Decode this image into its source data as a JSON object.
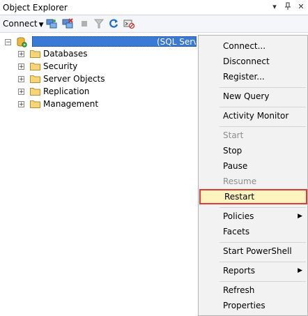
{
  "window": {
    "title": "Object Explorer",
    "pin_icon": "pin-icon",
    "dropdown_icon": "dropdown-icon",
    "close_icon": "close-icon"
  },
  "toolbar": {
    "connect_label": "Connect",
    "icons": [
      "connect-object-explorer-icon",
      "disconnect-icon",
      "stop-icon",
      "filter-icon",
      "refresh-icon",
      "start-powershell-icon"
    ]
  },
  "tree": {
    "server_label": "(SQL Server",
    "nodes": [
      {
        "label": "Databases"
      },
      {
        "label": "Security"
      },
      {
        "label": "Server Objects"
      },
      {
        "label": "Replication"
      },
      {
        "label": "Management"
      }
    ]
  },
  "context_menu": {
    "items": [
      {
        "label": "Connect...",
        "enabled": true
      },
      {
        "label": "Disconnect",
        "enabled": true
      },
      {
        "label": "Register...",
        "enabled": true
      },
      {
        "label": "New Query",
        "enabled": true
      },
      {
        "label": "Activity Monitor",
        "enabled": true
      },
      {
        "label": "Start",
        "enabled": false
      },
      {
        "label": "Stop",
        "enabled": true
      },
      {
        "label": "Pause",
        "enabled": true
      },
      {
        "label": "Resume",
        "enabled": false
      },
      {
        "label": "Restart",
        "enabled": true,
        "highlighted": true
      },
      {
        "label": "Policies",
        "enabled": true,
        "submenu": true
      },
      {
        "label": "Facets",
        "enabled": true
      },
      {
        "label": "Start PowerShell",
        "enabled": true
      },
      {
        "label": "Reports",
        "enabled": true,
        "submenu": true
      },
      {
        "label": "Refresh",
        "enabled": true
      },
      {
        "label": "Properties",
        "enabled": true
      }
    ]
  },
  "colors": {
    "highlight_border": "#e03a3a",
    "highlight_fill": "#fdf4bf",
    "selection": "#3a79d6"
  }
}
